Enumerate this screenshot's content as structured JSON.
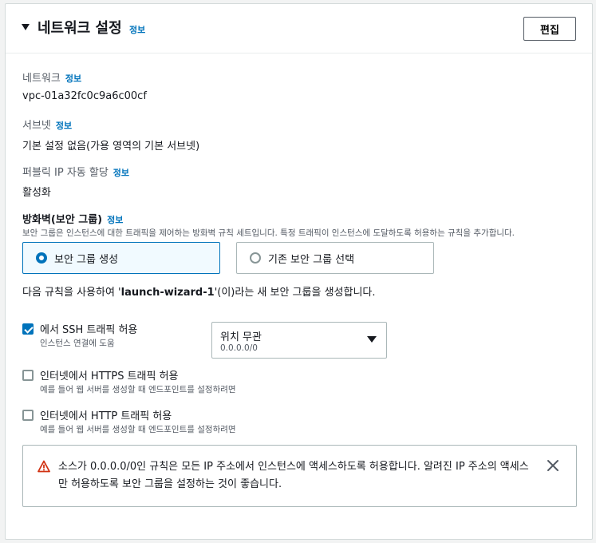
{
  "header": {
    "title": "네트워크 설정",
    "info": "정보",
    "edit_label": "편집"
  },
  "network": {
    "label": "네트워크",
    "info": "정보",
    "value": "vpc-01a32fc0c9a6c00cf"
  },
  "subnet": {
    "label": "서브넷",
    "info": "정보",
    "value": "기본 설정 없음(가용 영역의 기본 서브넷)"
  },
  "public_ip": {
    "label": "퍼블릭 IP 자동 할당",
    "info": "정보",
    "value": "활성화"
  },
  "security_group": {
    "title": "방화벽(보안 그룹)",
    "info": "정보",
    "description": "보안 그룹은 인스턴스에 대한 트래픽을 제어하는 방화벽 규칙 세트입니다. 특정 트래픽이 인스턴스에 도달하도록 허용하는 규칙을 추가합니다.",
    "option_create": "보안 그룹 생성",
    "option_existing": "기존 보안 그룹 선택",
    "rule_prefix": "다음 규칙을 사용하여 '",
    "rule_name": "launch-wizard-1",
    "rule_suffix": "'(이)라는 새 보안 그룹을 생성합니다."
  },
  "rules": {
    "ssh": {
      "label": "에서 SSH 트래픽 허용",
      "desc": "인스턴스 연결에 도움",
      "checked": true
    },
    "https": {
      "label": "인터넷에서 HTTPS 트래픽 허용",
      "desc": "예를 들어 웹 서버를 생성할 때 엔드포인트를 설정하려면",
      "checked": false
    },
    "http": {
      "label": "인터넷에서 HTTP 트래픽 허용",
      "desc": "예를 들어 웹 서버를 생성할 때 엔드포인트를 설정하려면",
      "checked": false
    }
  },
  "source_select": {
    "value": "위치 무관",
    "sub": "0.0.0.0/0"
  },
  "alert": {
    "text": "소스가 0.0.0.0/0인 규칙은 모든 IP 주소에서 인스턴스에 액세스하도록 허용합니다. 알려진 IP 주소의 액세스만 허용하도록 보안 그룹을 설정하는 것이 좋습니다."
  },
  "colors": {
    "accent": "#0073bb",
    "warning": "#d13212",
    "text": "#16191f",
    "muted": "#545b64"
  }
}
